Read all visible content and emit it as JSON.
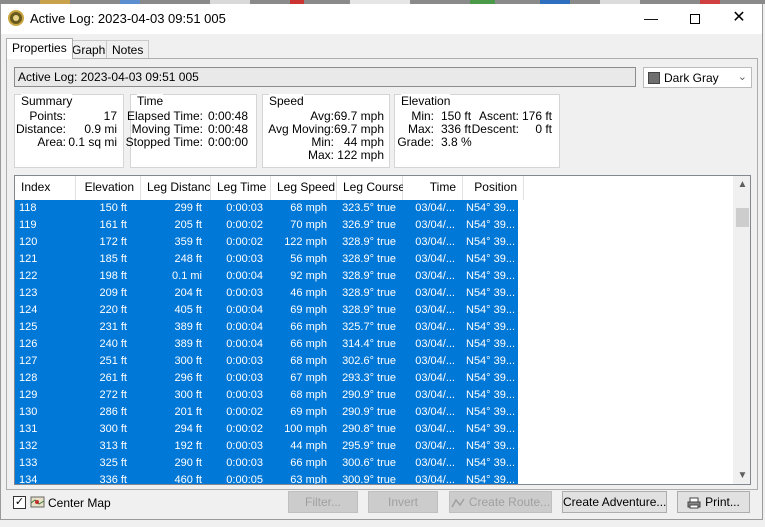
{
  "window": {
    "title": "Active Log: 2023-04-03 09:51 005"
  },
  "tabs": [
    "Properties",
    "Graph",
    "Notes"
  ],
  "name_field": {
    "value": "Active Log: 2023-04-03 09:51 005"
  },
  "color_select": {
    "value": "Dark Gray",
    "swatch": "#6f6f6f"
  },
  "summary": {
    "title": "Summary",
    "points_label": "Points:",
    "points": "17",
    "distance_label": "Distance:",
    "distance": "0.9 mi",
    "area_label": "Area:",
    "area": "0.1 sq mi"
  },
  "time": {
    "title": "Time",
    "elapsed_label": "Elapsed Time:",
    "elapsed": "0:00:48",
    "moving_label": "Moving Time:",
    "moving": "0:00:48",
    "stopped_label": "Stopped Time:",
    "stopped": "0:00:00"
  },
  "speed": {
    "title": "Speed",
    "avg_label": "Avg:",
    "avg": "69.7 mph",
    "avg_moving_label": "Avg Moving:",
    "avg_moving": "69.7 mph",
    "min_label": "Min:",
    "min": "44 mph",
    "max_label": "Max:",
    "max": "122 mph"
  },
  "elevation": {
    "title": "Elevation",
    "min_label": "Min:",
    "min": "150 ft",
    "max_label": "Max:",
    "max": "336 ft",
    "grade_label": "Grade:",
    "grade": "3.8 %",
    "ascent_label": "Ascent:",
    "ascent": "176 ft",
    "descent_label": "Descent:",
    "descent": "0 ft"
  },
  "table": {
    "columns": [
      "Index",
      "Elevation",
      "Leg Distance",
      "Leg Time",
      "Leg Speed",
      "Leg Course",
      "Time",
      "Position"
    ],
    "rows": [
      [
        "118",
        "150 ft",
        "299 ft",
        "0:00:03",
        "68 mph",
        "323.5° true",
        "03/04/...",
        "N54° 39..."
      ],
      [
        "119",
        "161 ft",
        "205 ft",
        "0:00:02",
        "70 mph",
        "326.9° true",
        "03/04/...",
        "N54° 39..."
      ],
      [
        "120",
        "172 ft",
        "359 ft",
        "0:00:02",
        "122 mph",
        "328.9° true",
        "03/04/...",
        "N54° 39..."
      ],
      [
        "121",
        "185 ft",
        "248 ft",
        "0:00:03",
        "56 mph",
        "328.9° true",
        "03/04/...",
        "N54° 39..."
      ],
      [
        "122",
        "198 ft",
        "0.1 mi",
        "0:00:04",
        "92 mph",
        "328.9° true",
        "03/04/...",
        "N54° 39..."
      ],
      [
        "123",
        "209 ft",
        "204 ft",
        "0:00:03",
        "46 mph",
        "328.9° true",
        "03/04/...",
        "N54° 39..."
      ],
      [
        "124",
        "220 ft",
        "405 ft",
        "0:00:04",
        "69 mph",
        "328.9° true",
        "03/04/...",
        "N54° 39..."
      ],
      [
        "125",
        "231 ft",
        "389 ft",
        "0:00:04",
        "66 mph",
        "325.7° true",
        "03/04/...",
        "N54° 39..."
      ],
      [
        "126",
        "240 ft",
        "389 ft",
        "0:00:04",
        "66 mph",
        "314.4° true",
        "03/04/...",
        "N54° 39..."
      ],
      [
        "127",
        "251 ft",
        "300 ft",
        "0:00:03",
        "68 mph",
        "302.6° true",
        "03/04/...",
        "N54° 39..."
      ],
      [
        "128",
        "261 ft",
        "296 ft",
        "0:00:03",
        "67 mph",
        "293.3° true",
        "03/04/...",
        "N54° 39..."
      ],
      [
        "129",
        "272 ft",
        "300 ft",
        "0:00:03",
        "68 mph",
        "290.9° true",
        "03/04/...",
        "N54° 39..."
      ],
      [
        "130",
        "286 ft",
        "201 ft",
        "0:00:02",
        "69 mph",
        "290.9° true",
        "03/04/...",
        "N54° 39..."
      ],
      [
        "131",
        "300 ft",
        "294 ft",
        "0:00:02",
        "100 mph",
        "290.8° true",
        "03/04/...",
        "N54° 39..."
      ],
      [
        "132",
        "313 ft",
        "192 ft",
        "0:00:03",
        "44 mph",
        "295.9° true",
        "03/04/...",
        "N54° 39..."
      ],
      [
        "133",
        "325 ft",
        "290 ft",
        "0:00:03",
        "66 mph",
        "300.6° true",
        "03/04/...",
        "N54° 39..."
      ],
      [
        "134",
        "336 ft",
        "460 ft",
        "0:00:05",
        "63 mph",
        "300.9° true",
        "03/04/...",
        "N54° 39..."
      ]
    ]
  },
  "bottom": {
    "center_map_label": "Center Map",
    "center_map_checked": true,
    "filter_label": "Filter...",
    "invert_label": "Invert",
    "create_route_label": "Create Route...",
    "create_adventure_label": "Create Adventure...",
    "print_label": "Print..."
  },
  "colors": {
    "selection": "#0078d7",
    "accent_icon": "#c9a640"
  }
}
